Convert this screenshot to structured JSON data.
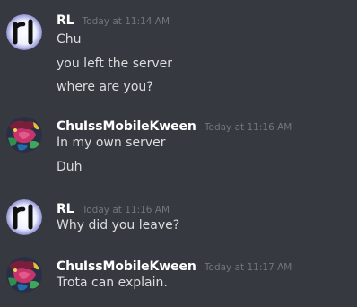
{
  "messages": [
    {
      "username": "RL",
      "timestamp": "Today at 11:14 AM",
      "avatar_icon": "rl-avatar-icon",
      "lines": [
        "Chu",
        "you left the server",
        "where are you?"
      ]
    },
    {
      "username": "ChuIssMobileKween",
      "timestamp": "Today at 11:16 AM",
      "avatar_icon": "pokemon-avatar-icon",
      "lines": [
        "In my own server",
        "Duh"
      ]
    },
    {
      "username": "RL",
      "timestamp": "Today at 11:16 AM",
      "avatar_icon": "rl-avatar-icon",
      "lines": [
        "Why did you leave?"
      ]
    },
    {
      "username": "ChuIssMobileKween",
      "timestamp": "Today at 11:17 AM",
      "avatar_icon": "pokemon-avatar-icon",
      "lines": [
        "Trota can explain."
      ]
    }
  ],
  "colors": {
    "background": "#36393f",
    "username": "#ffffff",
    "timestamp": "#72767d",
    "message_text": "#dcddde"
  }
}
